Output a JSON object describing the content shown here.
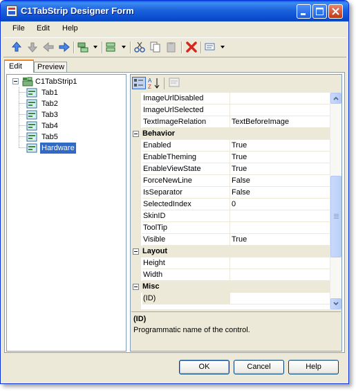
{
  "window": {
    "title": "C1TabStrip Designer Form"
  },
  "menu": [
    "File",
    "Edit",
    "Help"
  ],
  "toolbar_icons": [
    "move-up-icon",
    "move-down-icon",
    "move-left-icon",
    "move-right-icon",
    "add-child-icon",
    "add-sibling-icon",
    "cut-icon",
    "copy-icon",
    "paste-icon",
    "delete-icon",
    "change-type-icon"
  ],
  "tabs": {
    "edit": "Edit",
    "preview": "Preview"
  },
  "tree": {
    "root": "C1TabStrip1",
    "children": [
      "Tab1",
      "Tab2",
      "Tab3",
      "Tab4",
      "Tab5",
      "Hardware"
    ],
    "selected": "Hardware"
  },
  "properties": {
    "rows": [
      {
        "name": "ImageUrlDisabled",
        "value": ""
      },
      {
        "name": "ImageUrlSelected",
        "value": ""
      },
      {
        "name": "TextImageRelation",
        "value": "TextBeforeImage"
      },
      {
        "category": "Behavior"
      },
      {
        "name": "Enabled",
        "value": "True"
      },
      {
        "name": "EnableTheming",
        "value": "True"
      },
      {
        "name": "EnableViewState",
        "value": "True"
      },
      {
        "name": "ForceNewLine",
        "value": "False"
      },
      {
        "name": "IsSeparator",
        "value": "False"
      },
      {
        "name": "SelectedIndex",
        "value": "0"
      },
      {
        "name": "SkinID",
        "value": ""
      },
      {
        "name": "ToolTip",
        "value": ""
      },
      {
        "name": "Visible",
        "value": "True"
      },
      {
        "category": "Layout"
      },
      {
        "name": "Height",
        "value": ""
      },
      {
        "name": "Width",
        "value": ""
      },
      {
        "category": "Misc"
      },
      {
        "name": "(ID)",
        "value": "",
        "selected": true
      }
    ],
    "description_title": "(ID)",
    "description_text": "Programmatic name of the control."
  },
  "buttons": {
    "ok": "OK",
    "cancel": "Cancel",
    "help": "Help"
  },
  "colors": {
    "titlebar": "#0c4fd1",
    "selection": "#316ac5",
    "panel": "#ece9d8"
  }
}
